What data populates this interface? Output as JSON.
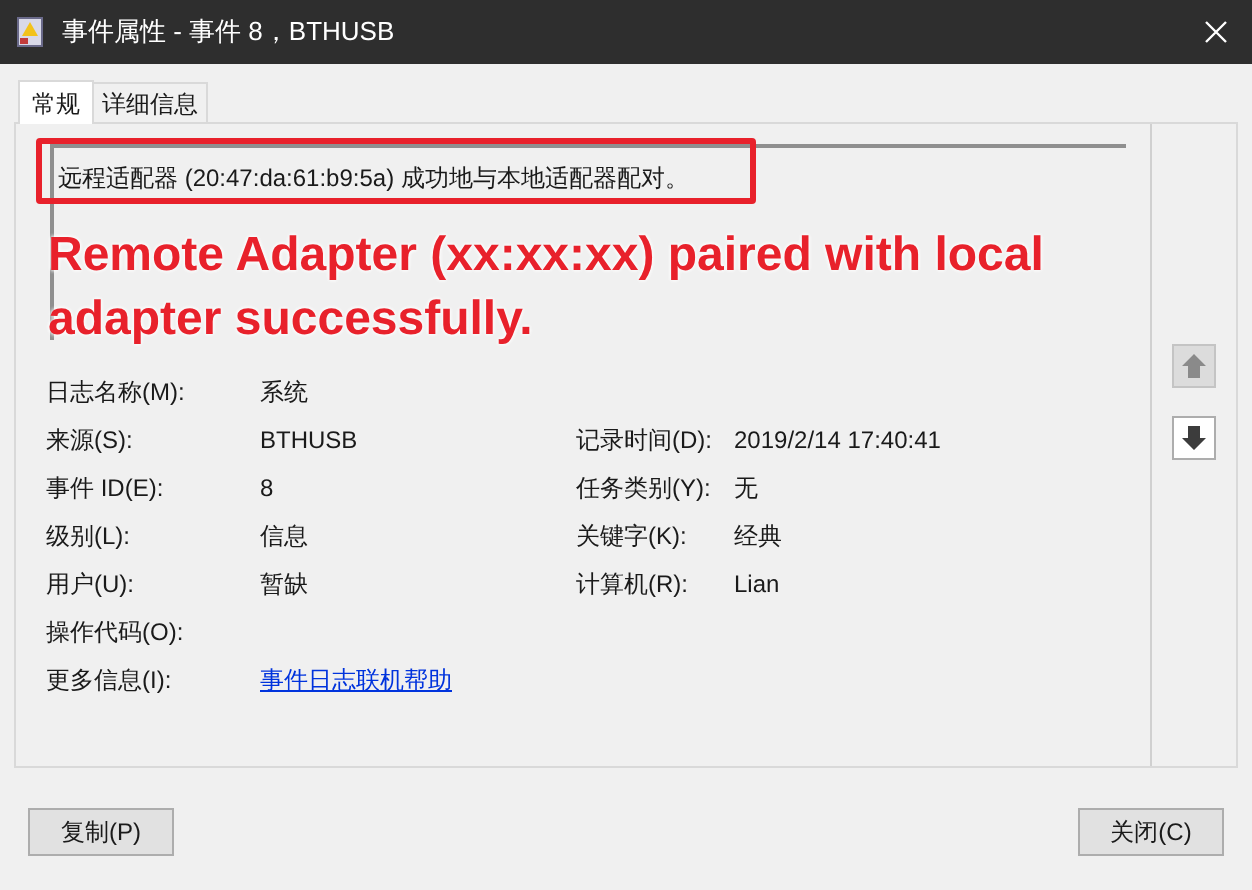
{
  "window": {
    "title": "事件属性 - 事件 8，BTHUSB"
  },
  "tabs": [
    {
      "label": "常规",
      "selected": true
    },
    {
      "label": "详细信息",
      "selected": false
    }
  ],
  "description": "远程适配器 (20:47:da:61:b9:5a) 成功地与本地适配器配对。",
  "annotation": {
    "text": "Remote Adapter (xx:xx:xx) paired with local adapter successfully.",
    "color": "#e8212b"
  },
  "fields": [
    {
      "label": "日志名称(M):",
      "value": "系统"
    },
    {
      "label": "来源(S):",
      "value": "BTHUSB",
      "label2": "记录时间(D):",
      "value2": "2019/2/14 17:40:41"
    },
    {
      "label": "事件 ID(E):",
      "value": "8",
      "label2": "任务类别(Y):",
      "value2": "无"
    },
    {
      "label": "级别(L):",
      "value": "信息",
      "label2": "关键字(K):",
      "value2": "经典"
    },
    {
      "label": "用户(U):",
      "value": "暂缺",
      "label2": "计算机(R):",
      "value2": "Lian"
    },
    {
      "label": "操作代码(O):"
    },
    {
      "label": "更多信息(I):",
      "link": "事件日志联机帮助"
    }
  ],
  "nav_buttons": [
    {
      "kind": "up",
      "disabled": true
    },
    {
      "kind": "down",
      "disabled": false
    }
  ],
  "buttons": [
    {
      "label": "复制(P)"
    },
    {
      "label": "关闭(C)"
    }
  ]
}
